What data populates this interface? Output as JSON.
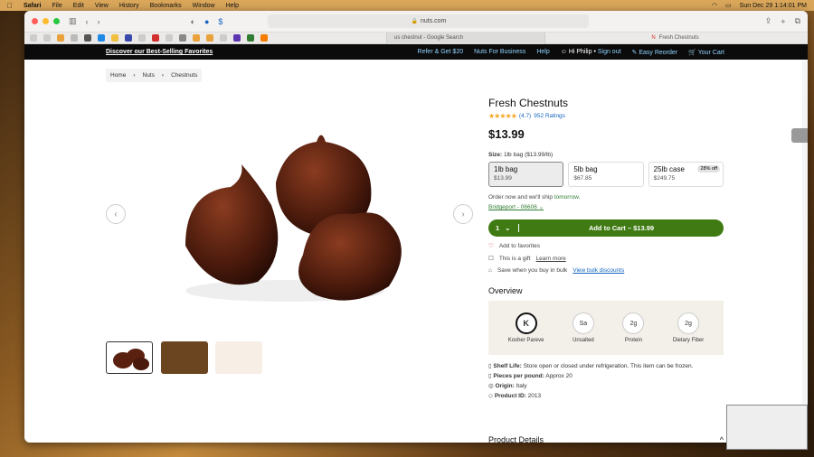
{
  "menubar": {
    "app": "Safari",
    "items": [
      "File",
      "Edit",
      "View",
      "History",
      "Bookmarks",
      "Window",
      "Help"
    ],
    "datetime": "Sun Dec 29  1:14:01 PM"
  },
  "browser": {
    "url": "nuts.com",
    "tab1": "us chestnut - Google Search",
    "tab2": "Fresh Chestnuts"
  },
  "topbar": {
    "promo": "Discover our Best-Selling Favorites",
    "refer": "Refer & Get $20",
    "business": "Nuts For Business",
    "help": "Help",
    "greeting": "Hi Philip",
    "signout": "Sign out",
    "reorder": "Easy Reorder",
    "cart": "Your Cart"
  },
  "breadcrumb": [
    "Home",
    "Nuts",
    "Chestnuts"
  ],
  "product": {
    "title": "Fresh Chestnuts",
    "rating": "(4.7)",
    "ratings_count": "952 Ratings",
    "stars": 4.7,
    "price": "$13.99",
    "size_label": "Size:",
    "size_value": "1lb bag ($13.99/lb)"
  },
  "sizes": [
    {
      "name": "1lb bag",
      "price": "$13.99",
      "badge": ""
    },
    {
      "name": "5lb bag",
      "price": "$67.85",
      "badge": ""
    },
    {
      "name": "25lb case",
      "price": "$249.75",
      "badge": "28% off"
    }
  ],
  "shipping": {
    "text": "Order now and we'll ship",
    "when": "tomorrow.",
    "location": "Bridgeport - 06606"
  },
  "cart": {
    "qty": "1",
    "button": "Add to Cart – $13.99"
  },
  "options": {
    "favorites": "Add to favorites",
    "gift": "This is a gift",
    "gift_link": "Learn more",
    "bulk": "Save when you buy in bulk",
    "bulk_link": "View bulk discounts"
  },
  "overview": {
    "heading": "Overview",
    "items": [
      {
        "icon": "K",
        "label": "Kosher Pareve"
      },
      {
        "icon": "Sa",
        "label": "Unsalted"
      },
      {
        "icon": "2g",
        "label": "Protein"
      },
      {
        "icon": "2g",
        "label": "Dietary Fiber"
      }
    ]
  },
  "details": [
    {
      "k": "Shelf Life:",
      "v": "Store open or closed under refrigeration. This item can be frozen."
    },
    {
      "k": "Pieces per pound:",
      "v": "Approx 20"
    },
    {
      "k": "Origin:",
      "v": "Italy"
    },
    {
      "k": "Product ID:",
      "v": "2013"
    }
  ],
  "product_details": "Product Details",
  "colors": {
    "green": "#3f7a12",
    "star": "#f5a623",
    "link": "#1565c0"
  }
}
